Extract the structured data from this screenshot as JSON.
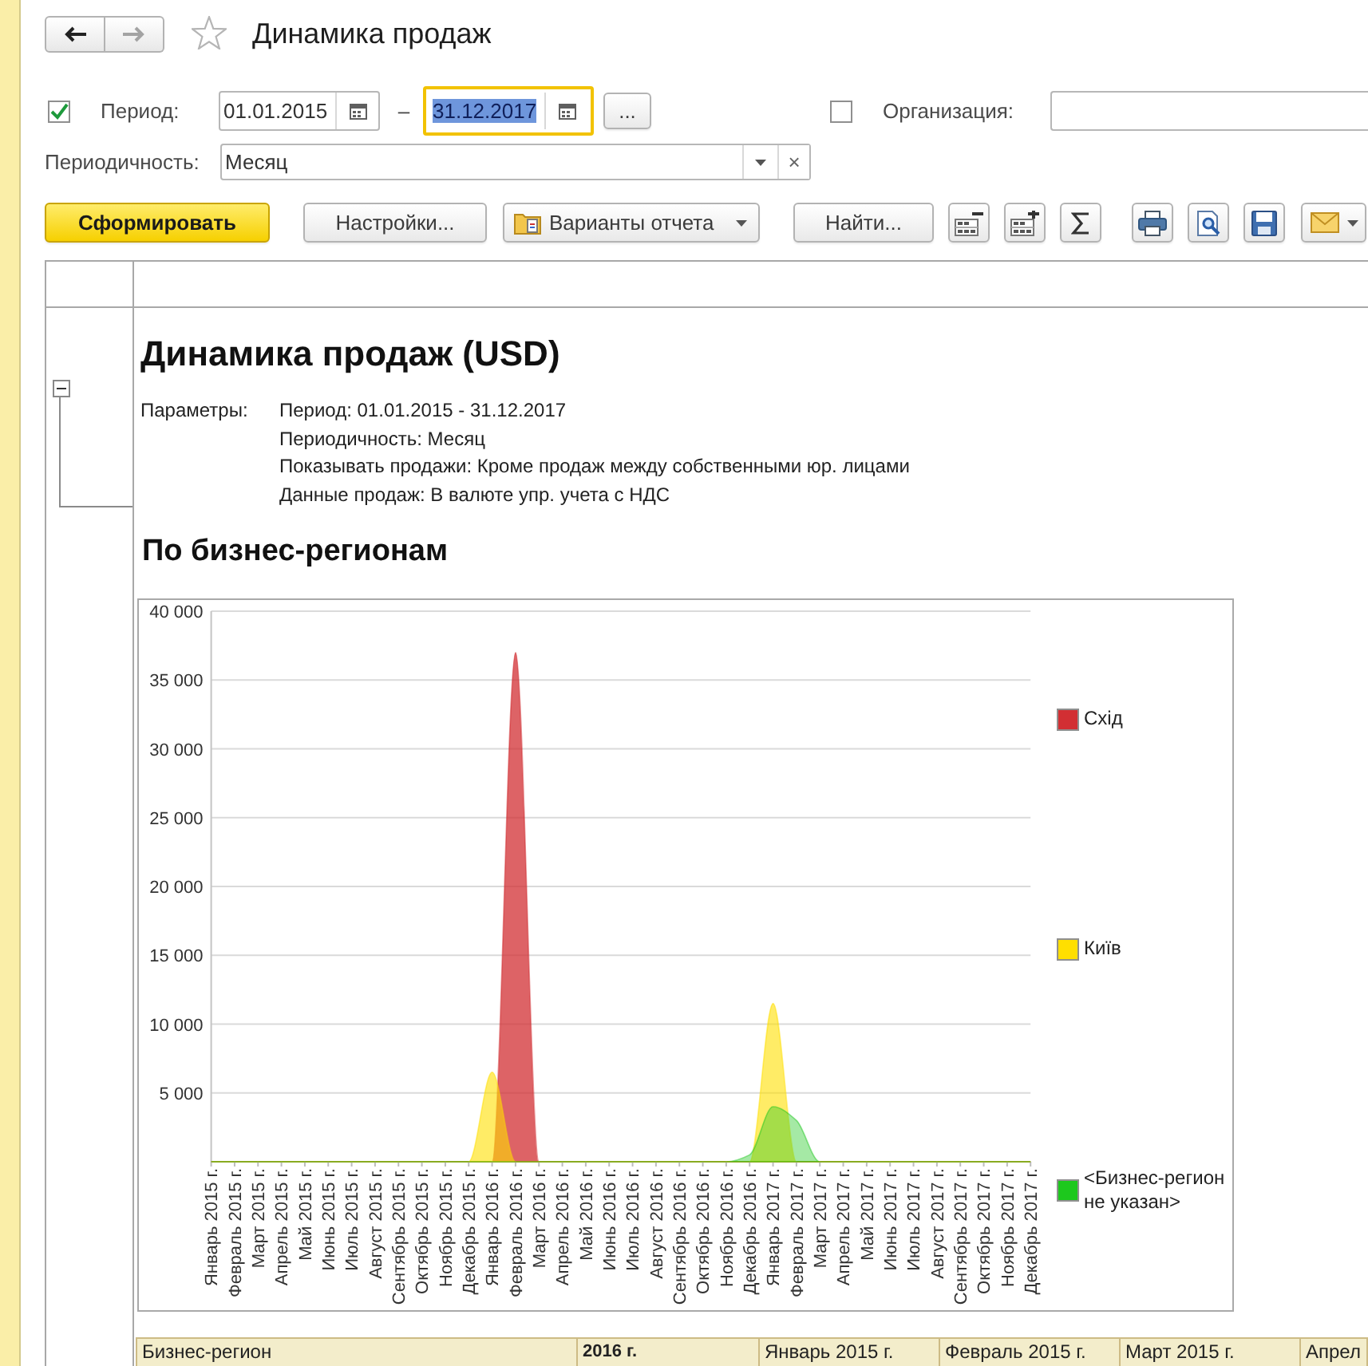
{
  "nav": {
    "back": {
      "disabled": false
    },
    "forward": {
      "disabled": true
    }
  },
  "window": {
    "title": "Динамика продаж",
    "favorite": false
  },
  "filters": {
    "period": {
      "checked": true,
      "label": "Период:",
      "date_from": {
        "value": "01.01.2015",
        "focused": false
      },
      "separator": "–",
      "date_to": {
        "value": "31.12.2017",
        "focused": true
      },
      "more_button": "..."
    },
    "organization": {
      "checked": false,
      "label": "Организация:"
    },
    "periodicity": {
      "label": "Периодичность:",
      "value": "Месяц",
      "clear_button": "×"
    }
  },
  "toolbar": {
    "buttons": [
      {
        "kind": "primary",
        "label": "Сформировать"
      },
      {
        "kind": "plain",
        "label": "Настройки..."
      },
      {
        "kind": "menu",
        "label": "Варианты отчета"
      },
      {
        "kind": "plain",
        "label": "Найти..."
      }
    ]
  },
  "report": {
    "title": "Динамика продаж (USD)",
    "group_expanded": true,
    "parameters_label": "Параметры:",
    "parameters": [
      "Период: 01.01.2015 - 31.12.2017",
      "Периодичность: Месяц",
      "Показывать продажи: Кроме продаж между собственными юр. лицами",
      "Данные продаж: В валюте упр. учета с НДС"
    ],
    "section_title": "По бизнес-регионам",
    "chart_data": {
      "type": "area",
      "categories": [
        "Январь 2015 г.",
        "Февраль 2015 г.",
        "Март 2015 г.",
        "Апрель 2015 г.",
        "Май 2015 г.",
        "Июнь 2015 г.",
        "Июль 2015 г.",
        "Август 2015 г.",
        "Сентябрь 2015 г.",
        "Октябрь 2015 г.",
        "Ноябрь 2015 г.",
        "Декабрь 2015 г.",
        "Январь 2016 г.",
        "Февраль 2016 г.",
        "Март 2016 г.",
        "Апрель 2016 г.",
        "Май 2016 г.",
        "Июнь 2016 г.",
        "Июль 2016 г.",
        "Август 2016 г.",
        "Сентябрь 2016 г.",
        "Октябрь 2016 г.",
        "Ноябрь 2016 г.",
        "Декабрь 2016 г.",
        "Январь 2017 г.",
        "Февраль 2017 г.",
        "Март 2017 г.",
        "Апрель 2017 г.",
        "Май 2017 г.",
        "Июнь 2017 г.",
        "Июль 2017 г.",
        "Август 2017 г.",
        "Сентябрь 2017 г.",
        "Октябрь 2017 г.",
        "Ноябрь 2017 г.",
        "Декабрь 2017 г."
      ],
      "series": [
        {
          "name": "Схід",
          "color": "#d22f33",
          "values": [
            0,
            0,
            0,
            0,
            0,
            0,
            0,
            0,
            0,
            0,
            0,
            0,
            0,
            37000,
            0,
            0,
            0,
            0,
            0,
            0,
            0,
            0,
            0,
            0,
            0,
            0,
            0,
            0,
            0,
            0,
            0,
            0,
            0,
            0,
            0,
            0
          ]
        },
        {
          "name": "Київ",
          "color": "#ffdf00",
          "values": [
            0,
            0,
            0,
            0,
            0,
            0,
            0,
            0,
            0,
            0,
            0,
            0,
            6500,
            0,
            0,
            0,
            0,
            0,
            0,
            0,
            0,
            0,
            0,
            0,
            11500,
            0,
            0,
            0,
            0,
            0,
            0,
            0,
            0,
            0,
            0,
            0
          ]
        },
        {
          "name": "<Бизнес-регион не указан>",
          "color": "#1dc81d",
          "values": [
            0,
            0,
            0,
            0,
            0,
            0,
            0,
            0,
            0,
            0,
            0,
            0,
            0,
            0,
            0,
            0,
            0,
            0,
            0,
            0,
            0,
            0,
            0,
            500,
            4000,
            3000,
            0,
            0,
            0,
            0,
            0,
            0,
            0,
            0,
            0,
            0
          ]
        }
      ],
      "ylim": [
        0,
        40000
      ],
      "yticks": [
        {
          "value": 5000,
          "label": "5 000"
        },
        {
          "value": 10000,
          "label": "10 000"
        },
        {
          "value": 15000,
          "label": "15 000"
        },
        {
          "value": 20000,
          "label": "20 000"
        },
        {
          "value": 25000,
          "label": "25 000"
        },
        {
          "value": 30000,
          "label": "30 000"
        },
        {
          "value": 35000,
          "label": "35 000"
        },
        {
          "value": 40000,
          "label": "40 000"
        }
      ],
      "grid": true,
      "legend": true
    },
    "table": {
      "columns": [
        {
          "kind": "dimension",
          "label": "Бизнес-регион"
        },
        {
          "kind": "year",
          "label": "2016 г."
        },
        {
          "kind": "month",
          "label": "Январь 2015 г."
        },
        {
          "kind": "month",
          "label": "Февраль 2015 г."
        },
        {
          "kind": "month",
          "label": "Март 2015 г."
        },
        {
          "kind": "month",
          "label": "Апрел"
        }
      ]
    }
  }
}
